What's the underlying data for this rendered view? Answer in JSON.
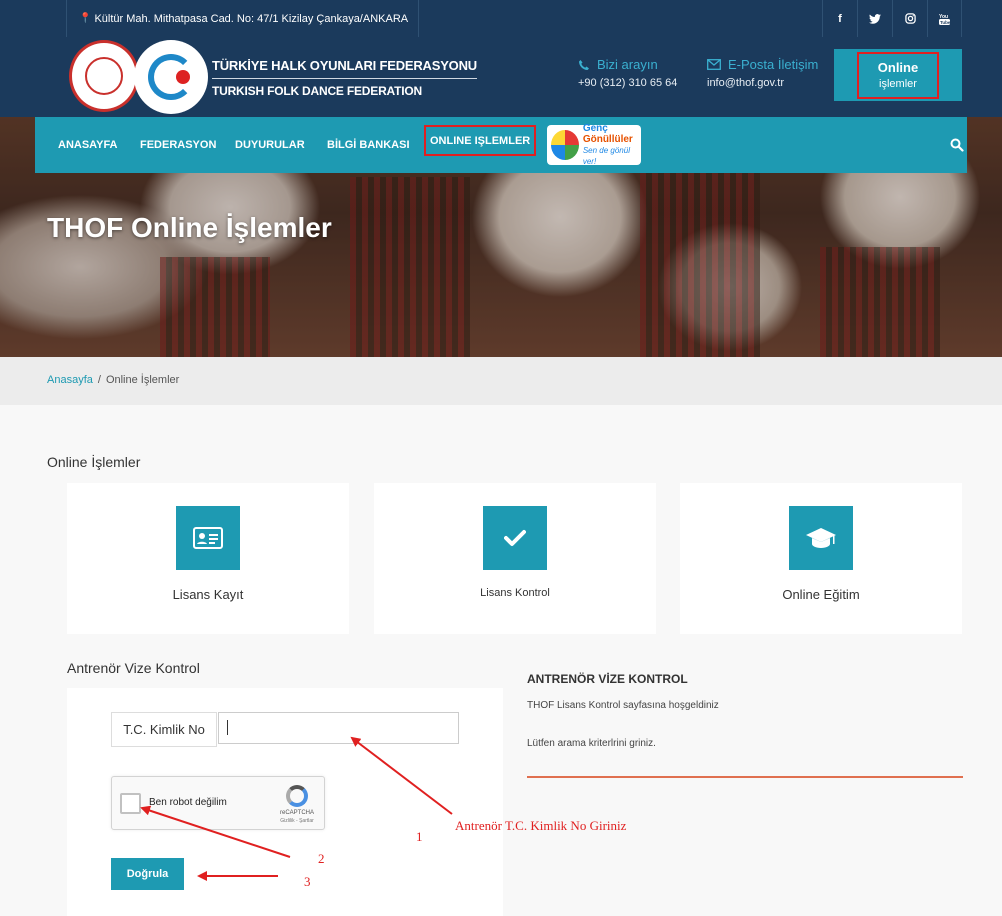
{
  "topbar": {
    "address": "Kültür Mah. Mithatpasa Cad. No: 47/1 Kizilay Çankaya/ANKARA",
    "socials": [
      {
        "icon": "facebook-icon",
        "glyph": "f"
      },
      {
        "icon": "twitter-icon",
        "glyph": "t"
      },
      {
        "icon": "instagram-icon",
        "glyph": "◎"
      },
      {
        "icon": "youtube-icon",
        "glyph": "▶"
      }
    ]
  },
  "header": {
    "brand_line1": "TÜRKİYE HALK OYUNLARI FEDERASYONU",
    "brand_line2": "TURKISH FOLK DANCE FEDERATION",
    "call_label": "Bizi arayın",
    "call_value": "+90 (312) 310 65 64",
    "mail_label": "E-Posta İletişim",
    "mail_value": "info@thof.gov.tr",
    "online_label1": "Online",
    "online_label2": "işlemler"
  },
  "nav": {
    "items": [
      "ANASAYFA",
      "FEDERASYON",
      "DUYURULAR",
      "BİLGİ BANKASI",
      "ONLINE IŞLEMLER"
    ],
    "gonullu_line1": "Genç",
    "gonullu_line2": "Gönüllüler",
    "gonullu_line3": "Sen de gönül ver!"
  },
  "hero": {
    "title": "THOF Online İşlemler"
  },
  "breadcrumb": {
    "home": "Anasayfa",
    "separator": "/",
    "current": "Online İşlemler"
  },
  "online_section": {
    "title": "Online İşlemler",
    "cards": [
      {
        "label": "Lisans Kayıt",
        "icon": "id-card-icon"
      },
      {
        "label": "Lisans Kontrol",
        "icon": "check-icon"
      },
      {
        "label": "Online Eğitim",
        "icon": "graduation-cap-icon"
      }
    ]
  },
  "vize": {
    "title": "Antrenör Vize Kontrol",
    "tc_label": "T.C. Kimlik No",
    "tc_value": "",
    "captcha_text": "Ben robot değilim",
    "captcha_brand": "reCAPTCHA",
    "captcha_privacy": "Gizlilik - Şartlar",
    "submit_label": "Doğrula"
  },
  "info": {
    "title": "ANTRENÖR VİZE KONTROL",
    "line1": "THOF Lisans Kontrol sayfasına hoşgeldiniz",
    "line2": "Lütfen arama kriterlrini griniz."
  },
  "annotations": {
    "instruction": "Antrenör T.C. Kimlik No Giriniz",
    "step1": "1",
    "step2": "2",
    "step3": "3"
  },
  "colors": {
    "navy": "#1b3a5c",
    "teal": "#1e9ab2",
    "annotation_red": "#e02020",
    "rule_orange": "#e07050"
  }
}
